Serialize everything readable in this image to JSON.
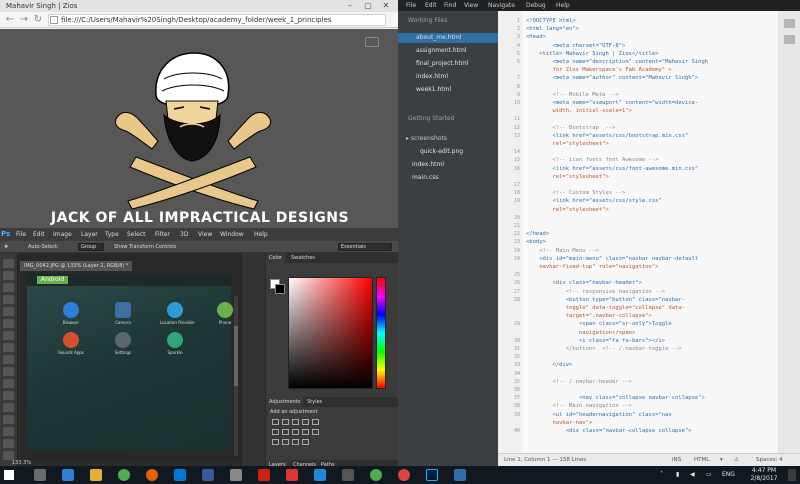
{
  "browser": {
    "tab_title": "Mahavir Singh | Zios",
    "url": "file:///C:/Users/Mahavir%20Singh/Desktop/academy_folder/week_1_principles",
    "heading": "JACK OF ALL IMPRACTICAL DESIGNS"
  },
  "photoshop": {
    "logo": "Ps",
    "menu": [
      "File",
      "Edit",
      "Image",
      "Layer",
      "Type",
      "Select",
      "Filter",
      "3D",
      "View",
      "Window",
      "Help"
    ],
    "options": {
      "auto_select": "Auto-Select:",
      "auto_select_value": "Group",
      "show_transform": "Show Transform Controls",
      "workspace": "Essentials"
    },
    "doc_tab": "IMG_0042.JPG @ 133% (Layer 2, RGB/8) *",
    "android_label": "Android",
    "apps": [
      {
        "label": "Browser",
        "color": "#2f7fd8"
      },
      {
        "label": "Camera",
        "color": "#3d6fa3"
      },
      {
        "label": "Location Provider",
        "color": "#2f9ad8"
      },
      {
        "label": "Phone",
        "color": "#6ab04c"
      },
      {
        "label": "Sounds Apps",
        "color": "#d84f2f"
      },
      {
        "label": "Settings",
        "color": "#5a6670"
      },
      {
        "label": "Sparkle",
        "color": "#2fa57a"
      }
    ],
    "zoom": "133.3%",
    "color_tabs": [
      "Color",
      "Swatches"
    ],
    "adjust_tabs": [
      "Adjustments",
      "Styles"
    ],
    "add_adjustment": "Add an adjustment",
    "layer_tabs": [
      "Layers",
      "Channels",
      "Paths"
    ]
  },
  "editor": {
    "menu": [
      "File",
      "Edit",
      "Find",
      "View",
      "Navigate",
      "Debug",
      "Help"
    ],
    "working_files_header": "Working Files",
    "working_files": [
      "about_me.html",
      "assignment.html",
      "final_project.html",
      "index.html",
      "week1.html"
    ],
    "getting_started": "Getting Started",
    "folder": "screenshots",
    "folder_files": [
      "quick-edit.png"
    ],
    "root_files": [
      "index.html",
      "main.css"
    ],
    "lines": [
      {
        "n": "1",
        "t": "<!DOCTYPE html>"
      },
      {
        "n": "2",
        "t": "<html lang=\"en\">"
      },
      {
        "n": "3",
        "t": "<head>"
      },
      {
        "n": "4",
        "t": "        <meta charset=\"UTF-8\">"
      },
      {
        "n": "5",
        "t": "    <title> Mahavir Singh | Zios</title>"
      },
      {
        "n": "6",
        "t": "        <meta name=\"description\" content=\"Mahavir Singh"
      },
      {
        "n": "",
        "t": "        for Zios Makerspace's Fab Academy\" >"
      },
      {
        "n": "7",
        "t": "        <meta name=\"author\" content=\"Mahavir Singh\">"
      },
      {
        "n": "8",
        "t": ""
      },
      {
        "n": "9",
        "t": "        <!-- Mobile Meta -->"
      },
      {
        "n": "10",
        "t": "        <meta name=\"viewport\" content=\"width=device-"
      },
      {
        "n": "",
        "t": "        width, initial-scale=1\">"
      },
      {
        "n": "11",
        "t": ""
      },
      {
        "n": "12",
        "t": "        <!-- Bootstrap  -->"
      },
      {
        "n": "13",
        "t": "        <link href=\"assets/css/bootstrap.min.css\""
      },
      {
        "n": "",
        "t": "        rel=\"stylesheet\">"
      },
      {
        "n": "14",
        "t": ""
      },
      {
        "n": "15",
        "t": "        <!-- icon fonts font Awesome -->"
      },
      {
        "n": "16",
        "t": "        <link href=\"assets/css/font-awesome.min.css\""
      },
      {
        "n": "",
        "t": "        rel=\"stylesheet\">"
      },
      {
        "n": "17",
        "t": ""
      },
      {
        "n": "18",
        "t": "        <!-- Custom Styles -->"
      },
      {
        "n": "19",
        "t": "        <link href=\"assets/css/style.css\""
      },
      {
        "n": "",
        "t": "        rel=\"stylesheet\">"
      },
      {
        "n": "20",
        "t": ""
      },
      {
        "n": "21",
        "t": ""
      },
      {
        "n": "22",
        "t": "</head>"
      },
      {
        "n": "23",
        "t": "<body>"
      },
      {
        "n": "24",
        "t": "    <!-- Main Menu -->"
      },
      {
        "n": "24",
        "t": "    <div id=\"main-menu\" class=\"navbar navbar-default"
      },
      {
        "n": "",
        "t": "    navbar-fixed-top\" role=\"navigation\">"
      },
      {
        "n": "25",
        "t": ""
      },
      {
        "n": "26",
        "t": "        <div class=\"navbar-header\">"
      },
      {
        "n": "27",
        "t": "            <!-- responsive navigation -->"
      },
      {
        "n": "28",
        "t": "            <button type=\"button\" class=\"navbar-"
      },
      {
        "n": "",
        "t": "            toggle\" data-toggle=\"collapse\" data-"
      },
      {
        "n": "",
        "t": "            target=\".navbar-collapse\">"
      },
      {
        "n": "29",
        "t": "                <span class=\"sr-only\">Toggle"
      },
      {
        "n": "",
        "t": "                navigation</span>"
      },
      {
        "n": "30",
        "t": "                <i class=\"fa fa-bars\"></i>"
      },
      {
        "n": "31",
        "t": "            </button>  <!-- /.navbar-toggle -->"
      },
      {
        "n": "32",
        "t": ""
      },
      {
        "n": "33",
        "t": "        </div>"
      },
      {
        "n": "34",
        "t": ""
      },
      {
        "n": "35",
        "t": "        <!-- /.navbar-header -->"
      },
      {
        "n": "36",
        "t": ""
      },
      {
        "n": "37",
        "t": "                <nav class=\"collapse navbar-collapse\">"
      },
      {
        "n": "38",
        "t": "        <!-- Main navigation -->"
      },
      {
        "n": "39",
        "t": "        <ul id=\"headernavigation\" class=\"nav"
      },
      {
        "n": "",
        "t": "        navbar-nav\">"
      },
      {
        "n": "40",
        "t": "            <div class=\"navbar-collapse collapse\">"
      }
    ],
    "status": {
      "position": "Line 1, Column 1 — 158 Lines",
      "ins": "INS",
      "mode": "HTML",
      "spaces": "Spaces: 4"
    }
  },
  "taskbar": {
    "lang": "ENG",
    "time": "4:47 PM",
    "date": "2/8/2017"
  }
}
